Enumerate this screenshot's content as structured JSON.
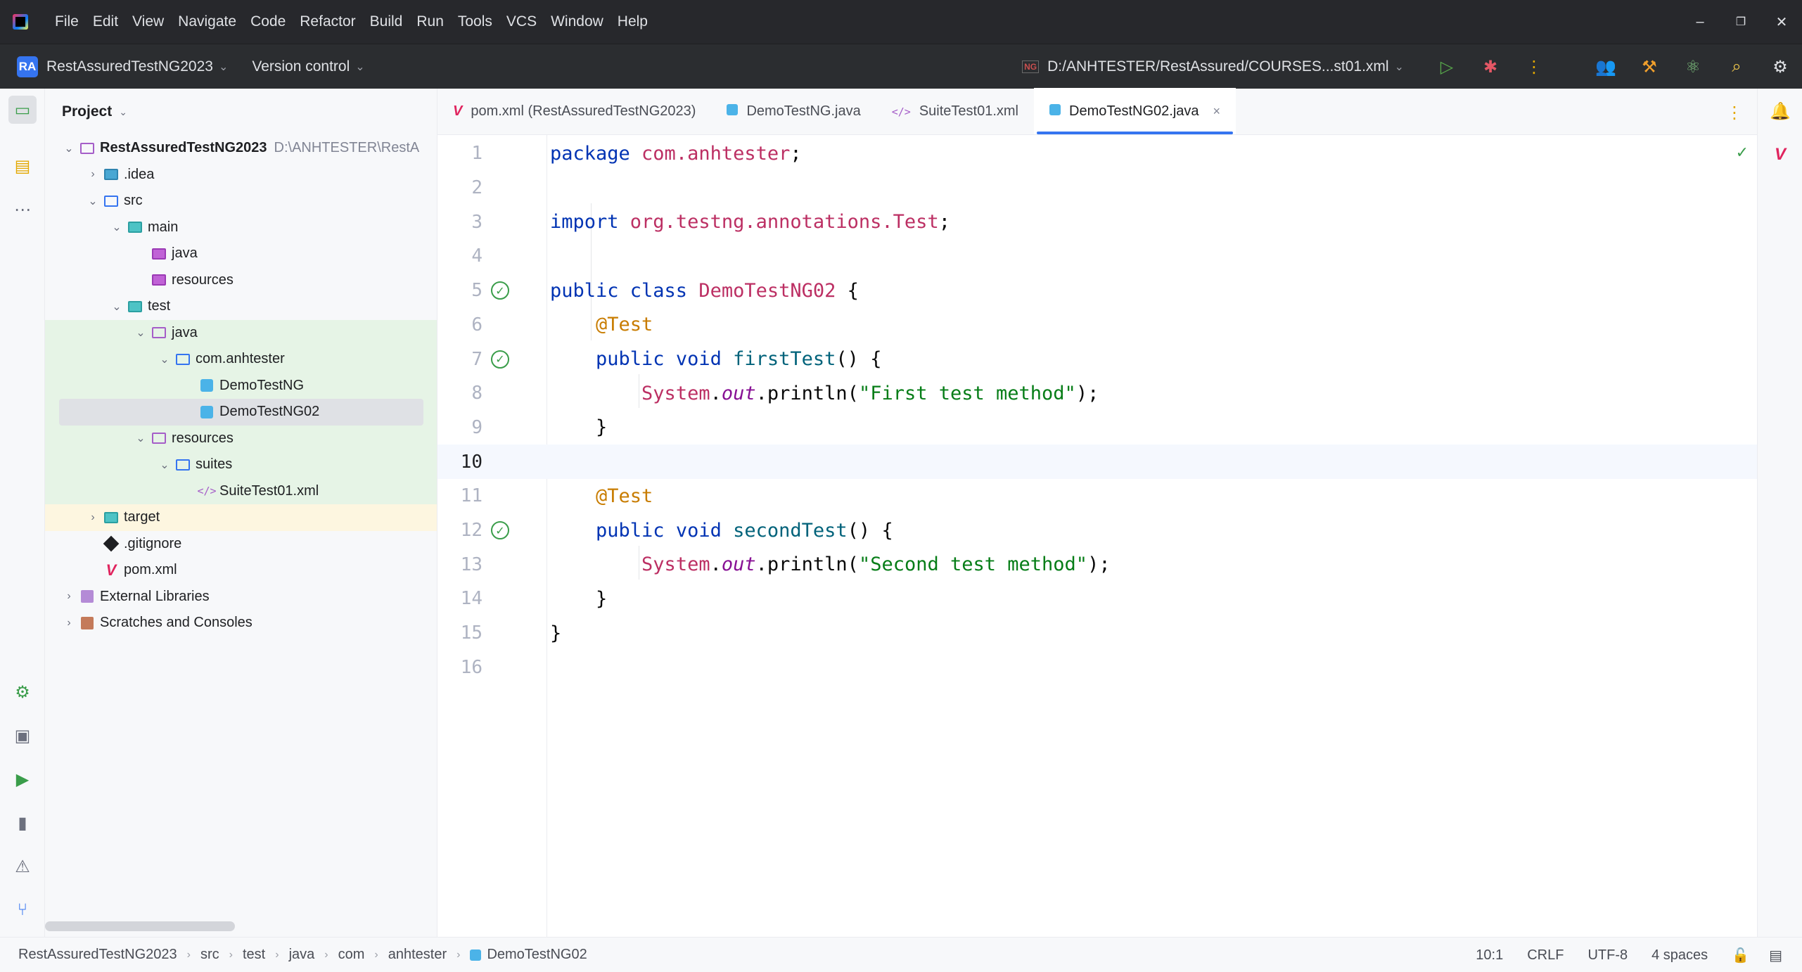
{
  "menu": {
    "items": [
      "File",
      "Edit",
      "View",
      "Navigate",
      "Code",
      "Refactor",
      "Build",
      "Run",
      "Tools",
      "VCS",
      "Window",
      "Help"
    ]
  },
  "window_controls": {
    "minimize": "–",
    "restore": "❐",
    "close": "✕"
  },
  "toolbar": {
    "project_badge": "RA",
    "project_name": "RestAssuredTestNG2023",
    "version_control": "Version control",
    "run_config": "D:/ANHTESTER/RestAssured/COURSES...st01.xml",
    "run_config_icon": "NG"
  },
  "project_panel": {
    "title": "Project",
    "tree": [
      {
        "label": "RestAssuredTestNG2023",
        "path": "D:\\ANHTESTER\\RestA",
        "depth": 0,
        "arrow": "down",
        "icon": "module-folder",
        "bold": true
      },
      {
        "label": ".idea",
        "depth": 1,
        "arrow": "right",
        "icon": "idea-folder"
      },
      {
        "label": "src",
        "depth": 1,
        "arrow": "down",
        "icon": "src-folder"
      },
      {
        "label": "main",
        "depth": 2,
        "arrow": "down",
        "icon": "main-folder"
      },
      {
        "label": "java",
        "depth": 3,
        "arrow": "",
        "icon": "java-folder"
      },
      {
        "label": "resources",
        "depth": 3,
        "arrow": "",
        "icon": "resources-folder"
      },
      {
        "label": "test",
        "depth": 2,
        "arrow": "down",
        "icon": "test-folder"
      },
      {
        "label": "java",
        "depth": 3,
        "arrow": "down",
        "icon": "test-java-folder",
        "bg": "green"
      },
      {
        "label": "com.anhtester",
        "depth": 4,
        "arrow": "down",
        "icon": "package-folder",
        "bg": "green"
      },
      {
        "label": "DemoTestNG",
        "depth": 5,
        "arrow": "",
        "icon": "java-class",
        "bg": "green"
      },
      {
        "label": "DemoTestNG02",
        "depth": 5,
        "arrow": "",
        "icon": "java-class",
        "bg": "green",
        "selected": true
      },
      {
        "label": "resources",
        "depth": 3,
        "arrow": "down",
        "icon": "test-resources-folder",
        "bg": "green"
      },
      {
        "label": "suites",
        "depth": 4,
        "arrow": "down",
        "icon": "package-folder",
        "bg": "green"
      },
      {
        "label": "SuiteTest01.xml",
        "depth": 5,
        "arrow": "",
        "icon": "xml-file",
        "bg": "green"
      },
      {
        "label": "target",
        "depth": 1,
        "arrow": "right",
        "icon": "target-folder",
        "bg": "yellow"
      },
      {
        "label": ".gitignore",
        "depth": 1,
        "arrow": "",
        "icon": "git-file"
      },
      {
        "label": "pom.xml",
        "depth": 1,
        "arrow": "",
        "icon": "maven-file"
      },
      {
        "label": "External Libraries",
        "depth": 0,
        "arrow": "right",
        "icon": "library"
      },
      {
        "label": "Scratches and Consoles",
        "depth": 0,
        "arrow": "right",
        "icon": "scratches"
      }
    ]
  },
  "tabs": [
    {
      "label": "pom.xml (RestAssuredTestNG2023)",
      "icon": "maven-file",
      "active": false
    },
    {
      "label": "DemoTestNG.java",
      "icon": "java-class",
      "active": false
    },
    {
      "label": "SuiteTest01.xml",
      "icon": "xml-file",
      "active": false
    },
    {
      "label": "DemoTestNG02.java",
      "icon": "java-class",
      "active": true,
      "close": "×"
    }
  ],
  "editor": {
    "current_line": 10,
    "lines": [
      {
        "n": "1",
        "tokens": [
          [
            "kw",
            "package "
          ],
          [
            "pkg",
            "com.anhtester"
          ],
          [
            "plain",
            ";"
          ]
        ]
      },
      {
        "n": "2",
        "tokens": []
      },
      {
        "n": "3",
        "tokens": [
          [
            "kw",
            "import "
          ],
          [
            "pkg",
            "org.testng.annotations."
          ],
          [
            "cls",
            "Test"
          ],
          [
            "plain",
            ";"
          ]
        ]
      },
      {
        "n": "4",
        "tokens": []
      },
      {
        "n": "5",
        "run": true,
        "tokens": [
          [
            "kw",
            "public class "
          ],
          [
            "cls",
            "DemoTestNG02"
          ],
          [
            "plain",
            " {"
          ]
        ]
      },
      {
        "n": "6",
        "tokens": [
          [
            "plain",
            "    "
          ],
          [
            "ann",
            "@Test"
          ]
        ]
      },
      {
        "n": "7",
        "run": true,
        "tokens": [
          [
            "plain",
            "    "
          ],
          [
            "kw",
            "public void "
          ],
          [
            "fn",
            "firstTest"
          ],
          [
            "plain",
            "() {"
          ]
        ]
      },
      {
        "n": "8",
        "tokens": [
          [
            "plain",
            "        "
          ],
          [
            "cls",
            "System"
          ],
          [
            "plain",
            "."
          ],
          [
            "fld",
            "out"
          ],
          [
            "plain",
            ".println("
          ],
          [
            "str",
            "\"First test method\""
          ],
          [
            "plain",
            ");"
          ]
        ]
      },
      {
        "n": "9",
        "tokens": [
          [
            "plain",
            "    }"
          ]
        ]
      },
      {
        "n": "10",
        "tokens": []
      },
      {
        "n": "11",
        "tokens": [
          [
            "plain",
            "    "
          ],
          [
            "ann",
            "@Test"
          ]
        ]
      },
      {
        "n": "12",
        "run": true,
        "tokens": [
          [
            "plain",
            "    "
          ],
          [
            "kw",
            "public void "
          ],
          [
            "fn",
            "secondTest"
          ],
          [
            "plain",
            "() {"
          ]
        ]
      },
      {
        "n": "13",
        "tokens": [
          [
            "plain",
            "        "
          ],
          [
            "cls",
            "System"
          ],
          [
            "plain",
            "."
          ],
          [
            "fld",
            "out"
          ],
          [
            "plain",
            ".println("
          ],
          [
            "str",
            "\"Second test method\""
          ],
          [
            "plain",
            ");"
          ]
        ]
      },
      {
        "n": "14",
        "tokens": [
          [
            "plain",
            "    }"
          ]
        ]
      },
      {
        "n": "15",
        "tokens": [
          [
            "plain",
            "}"
          ]
        ]
      },
      {
        "n": "16",
        "tokens": []
      }
    ]
  },
  "statusbar": {
    "breadcrumb": [
      "RestAssuredTestNG2023",
      "src",
      "test",
      "java",
      "com",
      "anhtester",
      "DemoTestNG02"
    ],
    "position": "10:1",
    "line_separator": "CRLF",
    "encoding": "UTF-8",
    "indent": "4 spaces"
  },
  "colors": {
    "accent": "#3574f0",
    "test_green": "#3a9d4a",
    "keyword": "#0033b3",
    "string": "#067d17",
    "annotation": "#c87c00"
  }
}
